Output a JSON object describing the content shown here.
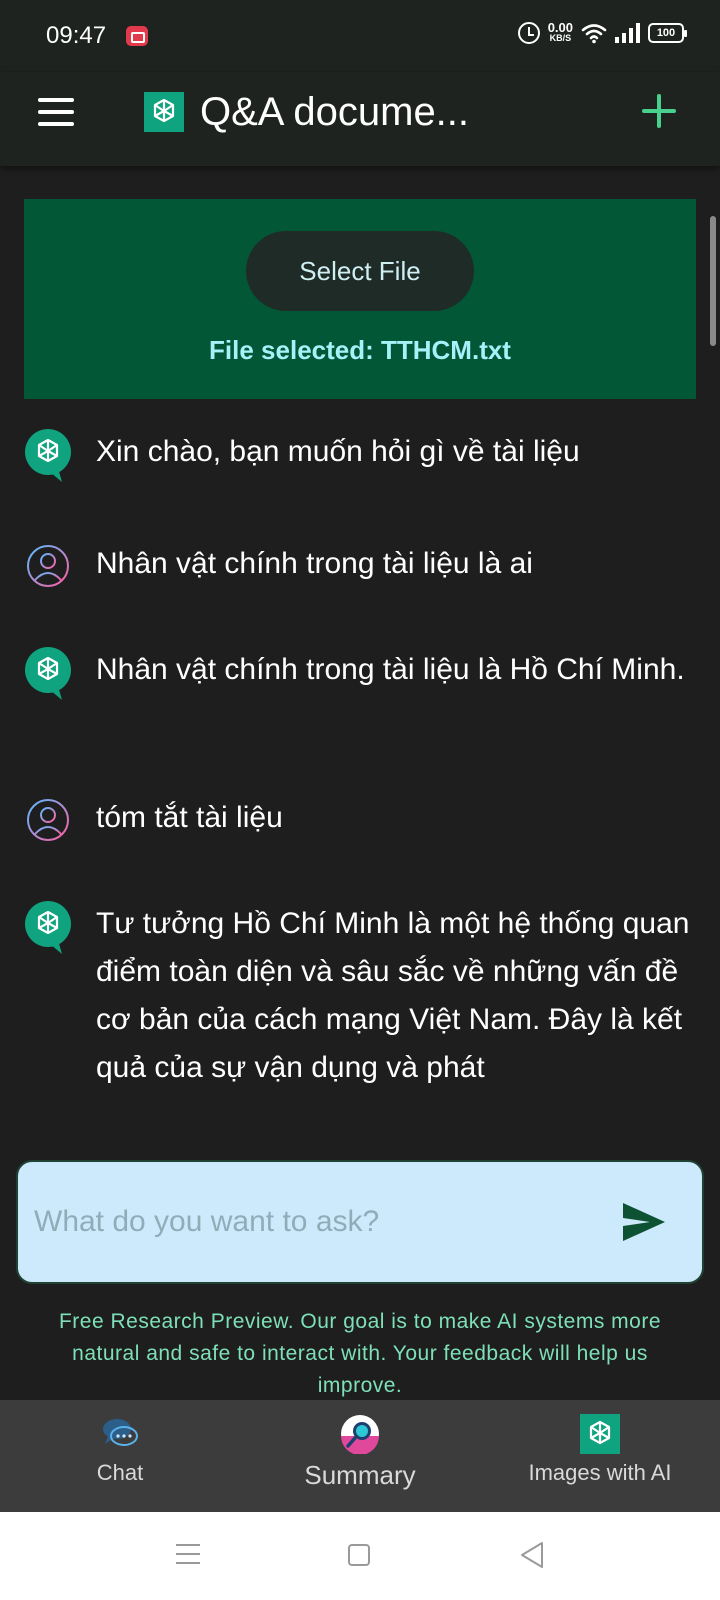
{
  "status_bar": {
    "time": "09:47",
    "net_speed_value": "0.00",
    "net_speed_unit": "KB/S",
    "battery": "100"
  },
  "app_bar": {
    "title": "Q&A docume...",
    "icons": {
      "menu": "hamburger-menu-icon",
      "logo": "openai-logo-icon",
      "add": "plus-icon"
    },
    "accent_color": "#47d18c"
  },
  "file_panel": {
    "select_button_label": "Select File",
    "file_selected_text": "File selected:  TTHCM.txt",
    "background_color": "#025737"
  },
  "messages": [
    {
      "role": "assistant",
      "text": "Xin chào, bạn muốn hỏi gì về tài liệu"
    },
    {
      "role": "user",
      "text": "Nhân vật chính trong tài liệu là ai"
    },
    {
      "role": "assistant",
      "text": "Nhân vật chính trong tài liệu là Hồ Chí Minh."
    },
    {
      "role": "user",
      "text": "tóm tắt tài liệu"
    },
    {
      "role": "assistant",
      "text": "Tư tưởng Hồ Chí Minh là một hệ thống quan điểm toàn diện và sâu sắc về những vấn đề cơ bản của cách mạng Việt Nam. Đây là kết quả của sự vận dụng và phát"
    }
  ],
  "input": {
    "placeholder": "What do you want to ask?",
    "value": ""
  },
  "disclaimer": "Free Research Preview. Our goal is to make AI systems more natural and safe to interact with. Your feedback will help us improve.",
  "bottom_nav": {
    "items": [
      {
        "label": "Chat",
        "icon": "chat-bubbles-icon",
        "active": false
      },
      {
        "label": "Summary",
        "icon": "summary-search-icon",
        "active": true
      },
      {
        "label": "Images with AI",
        "icon": "openai-logo-icon",
        "active": false
      }
    ]
  }
}
